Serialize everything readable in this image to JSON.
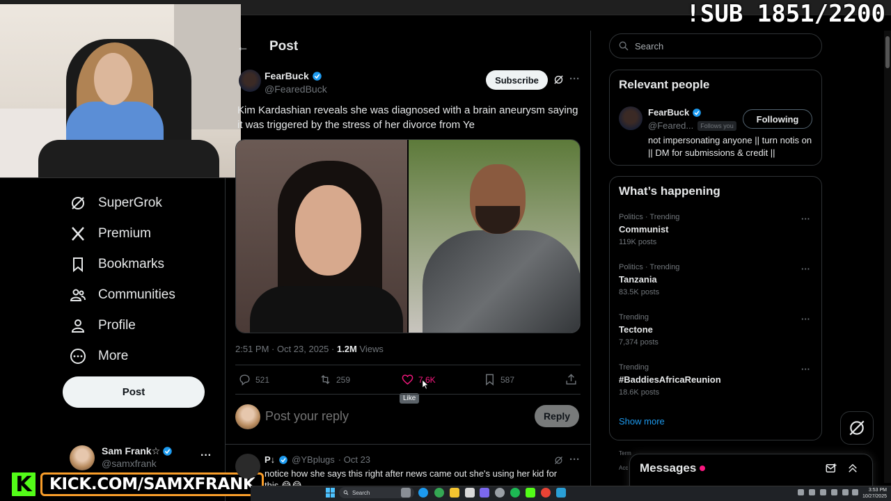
{
  "overlay": {
    "sub_counter": "!SUB 1851/2200",
    "kick_logo": "K",
    "kick_url": "KICK.COM/SAMXFRANK"
  },
  "nav": {
    "items": [
      {
        "label": "SuperGrok",
        "icon": "grok-icon"
      },
      {
        "label": "Premium",
        "icon": "x-logo-icon"
      },
      {
        "label": "Bookmarks",
        "icon": "bookmark-icon"
      },
      {
        "label": "Communities",
        "icon": "communities-icon"
      },
      {
        "label": "Profile",
        "icon": "profile-icon"
      },
      {
        "label": "More",
        "icon": "more-circle-icon"
      }
    ],
    "post_button": "Post",
    "account": {
      "name": "Sam Frank☆",
      "handle": "@samxfrank",
      "more": "···"
    }
  },
  "post": {
    "page_title": "Post",
    "back": "←",
    "author": {
      "name": "FearBuck",
      "handle": "@FearedBuck"
    },
    "subscribe": "Subscribe",
    "more": "···",
    "text": "Kim Kardashian reveals she was diagnosed with a brain aneurysm saying it was triggered by the stress of her divorce from Ye",
    "meta": {
      "time": "2:51 PM · Oct 23, 2025 · ",
      "views": "1.2M",
      "views_label": " Views"
    },
    "actions": {
      "replies": "521",
      "reposts": "259",
      "likes": "7.6K",
      "bookmarks": "587"
    },
    "like_tooltip": "Like"
  },
  "reply_box": {
    "placeholder": "Post your reply",
    "button": "Reply"
  },
  "comment": {
    "name": "P↓",
    "handle": "@YBplugs",
    "date": "· Oct 23",
    "text": "notice how she says this right after news came out she's using her kid for this 😂😂",
    "more": "···"
  },
  "right": {
    "search_placeholder": "Search",
    "relevant": {
      "title": "Relevant people",
      "name": "FearBuck",
      "handle": "@Feared...",
      "follows_you": "Follows you",
      "button": "Following",
      "bio": "not impersonating anyone || turn notis on || DM for submissions & credit ||"
    },
    "happening": {
      "title": "What’s happening",
      "trends": [
        {
          "category": "Politics · Trending",
          "name": "Communist",
          "count": "119K posts"
        },
        {
          "category": "Politics · Trending",
          "name": "Tanzania",
          "count": "83.5K posts"
        },
        {
          "category": "Trending",
          "name": "Tectone",
          "count": "7,374 posts"
        },
        {
          "category": "Trending",
          "name": "#BaddiesAfricaReunion",
          "count": "18.6K posts"
        }
      ],
      "more": "···",
      "show_more": "Show more"
    },
    "footer": {
      "terms": "Term",
      "acc": "Acc"
    }
  },
  "messages": {
    "title": "Messages"
  },
  "taskbar": {
    "search": "Search",
    "time": "3:53 PM",
    "date": "10/27/2025"
  },
  "colors": {
    "accent": "#1d9bf0",
    "like": "#f91880",
    "kick_green": "#53fc18",
    "kick_border": "#fa9e2a"
  }
}
